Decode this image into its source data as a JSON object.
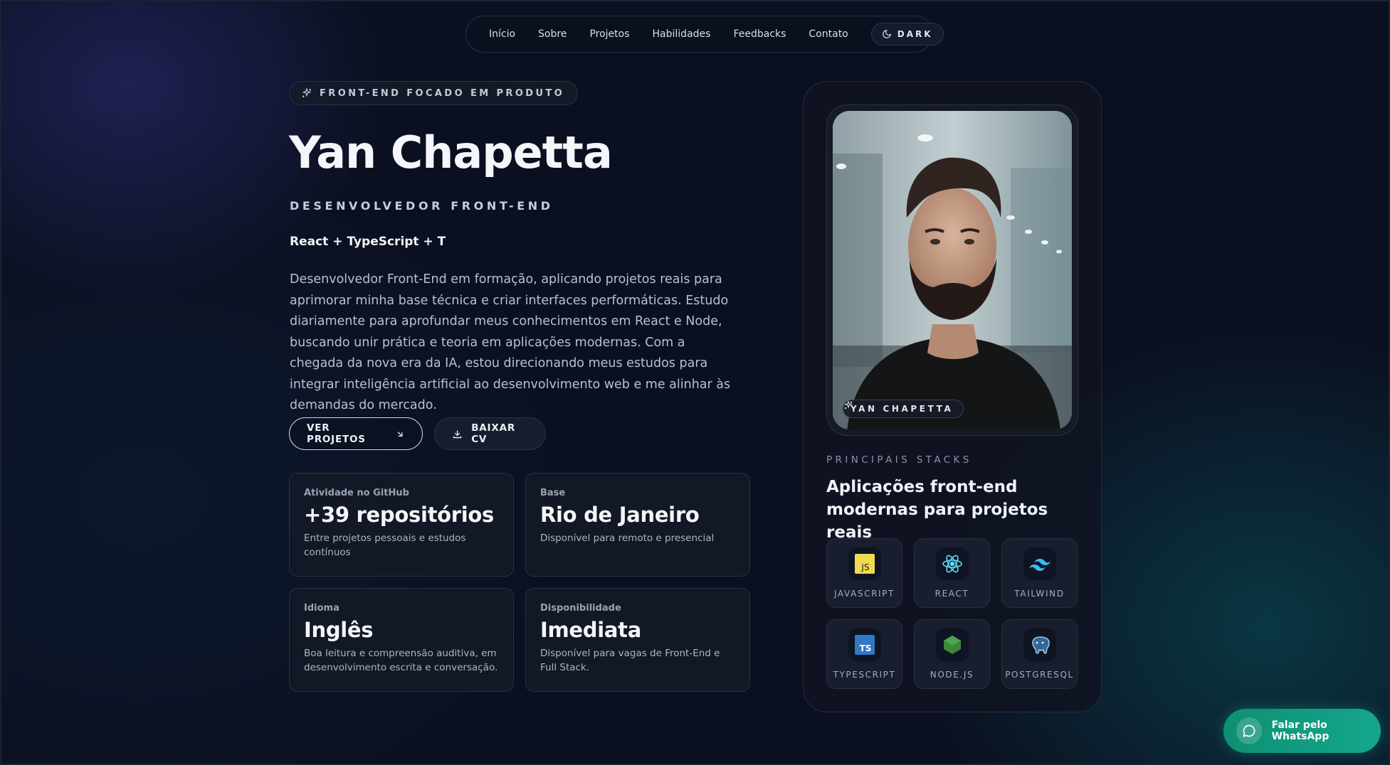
{
  "nav": {
    "links": [
      "Início",
      "Sobre",
      "Projetos",
      "Habilidades",
      "Feedbacks",
      "Contato"
    ],
    "theme_label": "DARK"
  },
  "hero": {
    "badge": "FRONT-END FOCADO EM PRODUTO",
    "name": "Yan Chapetta",
    "role": "DESENVOLVEDOR FRONT-END",
    "stack_line": "React + TypeScript + T",
    "description": "Desenvolvedor Front-End em formação, aplicando projetos reais para aprimorar minha base técnica e criar interfaces performáticas. Estudo diariamente para aprofundar meus conhecimentos em React e Node, buscando unir prática e teoria em aplicações modernas. Com a chegada da nova era da IA, estou direcionando meus estudos para integrar inteligência artificial ao desenvolvimento web e me alinhar às demandas do mercado.",
    "primary_button": "VER PROJETOS",
    "secondary_button": "BAIXAR CV"
  },
  "info_cards": [
    {
      "label": "Atividade no GitHub",
      "value": "+39 repositórios",
      "desc": "Entre projetos pessoais e estudos contínuos"
    },
    {
      "label": "Base",
      "value": "Rio de Janeiro",
      "desc": "Disponível para remoto e presencial"
    },
    {
      "label": "Idioma",
      "value": "Inglês",
      "desc": "Boa leitura e compreensão auditiva, em desenvolvimento escrita e conversação."
    },
    {
      "label": "Disponibilidade",
      "value": "Imediata",
      "desc": "Disponível para vagas de Front-End e Full Stack."
    }
  ],
  "profile": {
    "photo_tag": "YAN CHAPETTA",
    "stacks_kicker": "PRINCIPAIS STACKS",
    "stacks_title": "Aplicações front-end modernas para projetos reais",
    "techs": [
      {
        "label": "JAVASCRIPT",
        "icon": "javascript-icon",
        "color": "#f0db4f"
      },
      {
        "label": "REACT",
        "icon": "react-icon",
        "color": "#61dafb"
      },
      {
        "label": "TAILWIND",
        "icon": "tailwind-icon",
        "color": "#38bdf8"
      },
      {
        "label": "TYPESCRIPT",
        "icon": "typescript-icon",
        "color": "#3178c6"
      },
      {
        "label": "NODE.JS",
        "icon": "nodejs-icon",
        "color": "#3c873a"
      },
      {
        "label": "POSTGRESQL",
        "icon": "postgresql-icon",
        "color": "#336791"
      }
    ]
  },
  "whatsapp": {
    "label": "Falar pelo WhatsApp"
  },
  "colors": {
    "background": "#0b1020",
    "whatsapp": "#14a78c",
    "panel": "#0f1421"
  }
}
